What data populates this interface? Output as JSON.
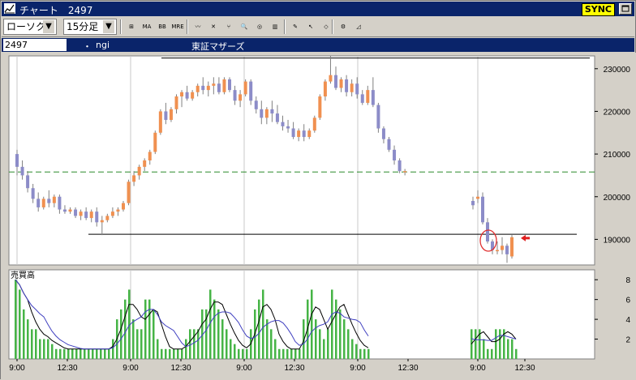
{
  "window": {
    "title": "チャート　2497",
    "sync_label": "SYNC"
  },
  "toolbar": {
    "chart_type": "ローソク",
    "interval": "15分足",
    "buttons": [
      {
        "name": "table-icon",
        "label": "⊞"
      },
      {
        "name": "ma-button",
        "label": "MA"
      },
      {
        "name": "bb-button",
        "label": "BB"
      },
      {
        "name": "mre-button",
        "label": "MRE"
      },
      {
        "name": "line-tool-icon",
        "label": "〰"
      },
      {
        "name": "cross-tool-icon",
        "label": "✕"
      },
      {
        "name": "fork-tool-icon",
        "label": "⑂"
      },
      {
        "name": "zoom-icon",
        "label": "🔍"
      },
      {
        "name": "sphere-icon",
        "label": "◎"
      },
      {
        "name": "bars-icon",
        "label": "▥"
      },
      {
        "name": "pencil-icon",
        "label": "✎"
      },
      {
        "name": "cursor-icon",
        "label": "↖"
      },
      {
        "name": "eraser-icon",
        "label": "◇"
      },
      {
        "name": "settings-icon",
        "label": "⚙"
      },
      {
        "name": "fibonacci-icon",
        "label": "◿"
      }
    ]
  },
  "info": {
    "code": "2497",
    "separator": "・",
    "sub": "ngi",
    "market": "東証マザーズ"
  },
  "colors": {
    "up": "#f09050",
    "down": "#8c8cc8",
    "volume": "#46b446",
    "dashed_level": "#2a8a2a",
    "highlight_circle": "#e03030",
    "arrow": "#e02020"
  },
  "chart_data": {
    "type": "candlestick",
    "price_axis": {
      "ticks": [
        230000,
        220000,
        210000,
        200000,
        190000
      ],
      "range": [
        184000,
        233000
      ]
    },
    "volume_axis": {
      "label": "売買高",
      "ticks": [
        8,
        6,
        4,
        2
      ],
      "range": [
        0,
        9
      ]
    },
    "x_tick_labels": [
      "9:00",
      "12:30",
      "9:00",
      "12:30",
      "9:00",
      "12:30",
      "9:00",
      "12:30",
      "9:00",
      "12:30"
    ],
    "reference_lines": {
      "dashed_horizontal": 205800,
      "upper_horizontal": 232500,
      "lower_horizontal": 191200
    },
    "candles": [
      [
        210000,
        211000,
        205000,
        207000
      ],
      [
        207000,
        208500,
        204000,
        205000
      ],
      [
        205000,
        206000,
        201000,
        202000
      ],
      [
        202000,
        203000,
        198500,
        199500
      ],
      [
        199500,
        201000,
        196500,
        197500
      ],
      [
        197500,
        200000,
        197000,
        199500
      ],
      [
        199500,
        201500,
        197500,
        198500
      ],
      [
        198500,
        200500,
        197500,
        200000
      ],
      [
        200000,
        200500,
        196000,
        197000
      ],
      [
        197000,
        198000,
        196000,
        196500
      ],
      [
        196500,
        197500,
        196000,
        197000
      ],
      [
        197000,
        197500,
        195000,
        195500
      ],
      [
        195500,
        197000,
        194500,
        196500
      ],
      [
        196500,
        197500,
        194500,
        195000
      ],
      [
        195000,
        197000,
        194000,
        196500
      ],
      [
        196500,
        197500,
        193000,
        194000
      ],
      [
        194000,
        195500,
        191000,
        194500
      ],
      [
        194500,
        196000,
        194000,
        195500
      ],
      [
        195500,
        197500,
        195000,
        196500
      ],
      [
        196500,
        197500,
        195500,
        197000
      ],
      [
        197000,
        199000,
        196500,
        198500
      ],
      [
        198500,
        204000,
        198000,
        203500
      ],
      [
        203500,
        206000,
        202500,
        205000
      ],
      [
        205000,
        207500,
        204000,
        207000
      ],
      [
        207000,
        209000,
        206000,
        208500
      ],
      [
        208500,
        211000,
        207500,
        210500
      ],
      [
        210500,
        215500,
        210000,
        215000
      ],
      [
        215000,
        220500,
        214500,
        220000
      ],
      [
        220000,
        222000,
        217000,
        218000
      ],
      [
        218000,
        221000,
        217500,
        220500
      ],
      [
        220500,
        224000,
        219500,
        223500
      ],
      [
        223500,
        225000,
        221000,
        224500
      ],
      [
        224500,
        226000,
        222500,
        223000
      ],
      [
        223000,
        225000,
        222500,
        224500
      ],
      [
        224500,
        226500,
        223500,
        226000
      ],
      [
        226000,
        228000,
        224000,
        225000
      ],
      [
        225000,
        227000,
        223500,
        226000
      ],
      [
        226000,
        228000,
        224000,
        226500
      ],
      [
        226500,
        228000,
        224000,
        224500
      ],
      [
        224500,
        228000,
        224000,
        227500
      ],
      [
        227500,
        228000,
        224500,
        225000
      ],
      [
        225000,
        226000,
        221500,
        222500
      ],
      [
        222500,
        225000,
        221000,
        224000
      ],
      [
        224000,
        227500,
        223500,
        227000
      ],
      [
        227000,
        227500,
        221500,
        222500
      ],
      [
        222500,
        223500,
        219500,
        220500
      ],
      [
        220500,
        222500,
        217000,
        218500
      ],
      [
        218500,
        221000,
        217000,
        220500
      ],
      [
        220500,
        222500,
        217500,
        219500
      ],
      [
        219500,
        221500,
        217000,
        217500
      ],
      [
        217500,
        219000,
        215500,
        216500
      ],
      [
        216500,
        218000,
        215000,
        216000
      ],
      [
        216000,
        217500,
        213500,
        214000
      ],
      [
        214000,
        216000,
        213000,
        215500
      ],
      [
        215500,
        217000,
        213000,
        214000
      ],
      [
        214000,
        216000,
        213500,
        215500
      ],
      [
        215500,
        219000,
        215000,
        218500
      ],
      [
        218500,
        224000,
        218000,
        223500
      ],
      [
        223500,
        227500,
        222500,
        227000
      ],
      [
        227000,
        233000,
        226500,
        228500
      ],
      [
        228500,
        230500,
        225000,
        225500
      ],
      [
        225500,
        228000,
        224500,
        227500
      ],
      [
        227500,
        228500,
        223500,
        224500
      ],
      [
        224500,
        227500,
        223500,
        226500
      ],
      [
        226500,
        228000,
        223000,
        224000
      ],
      [
        224000,
        225000,
        221500,
        222000
      ],
      [
        222000,
        226000,
        221500,
        225000
      ],
      [
        225000,
        228000,
        221000,
        221500
      ],
      [
        221500,
        222000,
        215000,
        216000
      ],
      [
        216000,
        216500,
        212500,
        213500
      ],
      [
        213500,
        214000,
        210500,
        211000
      ],
      [
        211000,
        212000,
        207500,
        208500
      ],
      [
        208500,
        209000,
        205500,
        206000
      ],
      [
        206000,
        206500,
        205000,
        206000
      ],
      [
        199000,
        200000,
        197000,
        198000
      ],
      [
        199500,
        201500,
        198500,
        200000
      ],
      [
        200000,
        201000,
        193500,
        194000
      ],
      [
        194000,
        195000,
        189000,
        189500
      ],
      [
        189500,
        190000,
        186500,
        187500
      ],
      [
        187500,
        189500,
        186500,
        187500
      ],
      [
        187500,
        190500,
        186500,
        188500
      ],
      [
        188500,
        189000,
        184500,
        186500
      ],
      [
        186000,
        191000,
        185500,
        190500
      ]
    ],
    "volume": [
      8,
      7,
      5,
      4,
      3,
      3,
      2,
      2,
      2,
      1.5,
      1,
      1,
      1,
      1,
      1,
      1,
      1,
      1,
      1,
      1,
      1,
      1,
      1,
      1,
      2,
      4,
      5,
      6,
      7,
      4,
      3,
      3,
      6,
      6,
      5,
      2,
      1,
      1,
      1,
      1,
      1,
      1,
      2,
      3,
      3,
      3,
      5,
      5,
      7,
      6,
      5,
      4,
      3,
      2,
      1.5,
      1,
      1,
      1,
      3,
      5,
      6,
      7,
      4,
      3,
      2,
      1,
      1,
      1,
      1,
      1,
      1,
      4,
      6,
      7,
      4,
      3,
      2,
      3,
      7,
      6,
      5,
      4,
      3,
      2,
      1.5,
      1,
      1,
      1,
      3,
      3,
      3,
      2,
      1,
      1,
      3,
      3,
      3,
      2,
      2,
      1
    ]
  }
}
